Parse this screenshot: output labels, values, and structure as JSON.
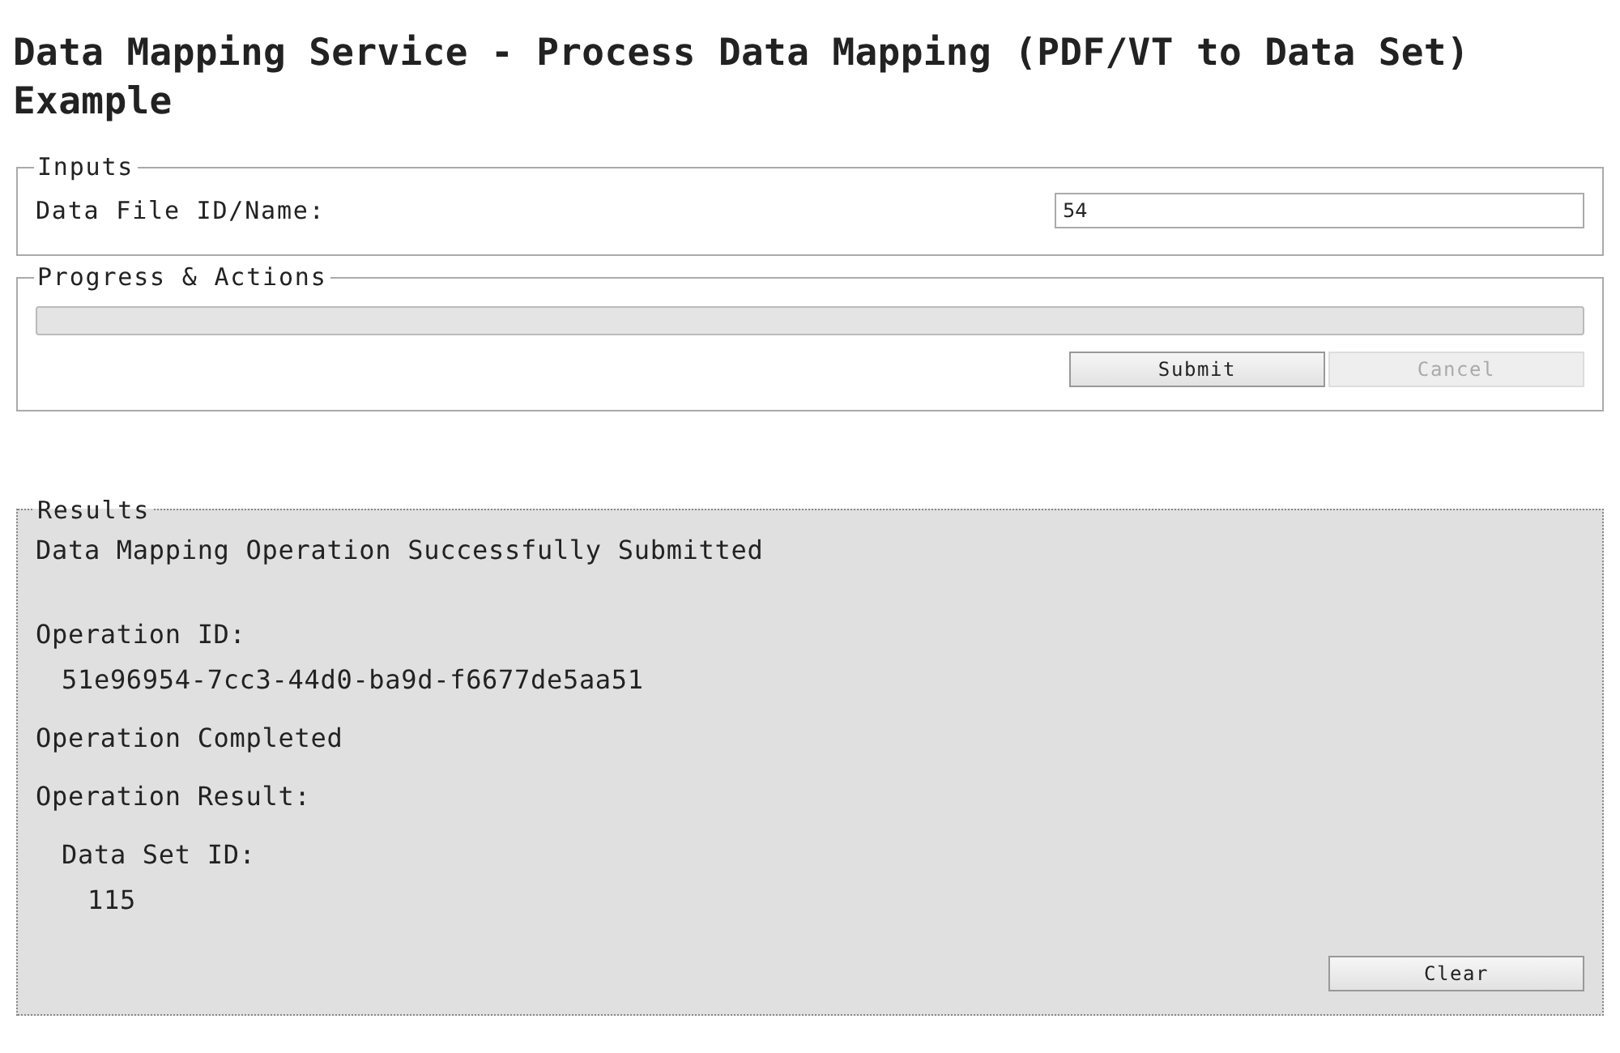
{
  "title": "Data Mapping Service - Process Data Mapping (PDF/VT to Data Set) Example",
  "inputs": {
    "legend": "Inputs",
    "fields": [
      {
        "label": "Data File ID/Name:",
        "value": "54"
      }
    ]
  },
  "progress": {
    "legend": "Progress & Actions",
    "level": 0,
    "buttons": [
      {
        "label": "Submit",
        "disabled": false
      },
      {
        "label": "Cancel",
        "disabled": true
      }
    ]
  },
  "results": {
    "legend": "Results",
    "items": [
      {
        "text": "Data Mapping Operation Successfully Submitted"
      },
      {
        "text": "Operation ID:",
        "children": [
          {
            "text": "51e96954-7cc3-44d0-ba9d-f6677de5aa51"
          }
        ]
      },
      {
        "text": "Operation Completed"
      },
      {
        "text": "Operation Result:",
        "children": [
          {
            "text": "Data Set ID:",
            "children": [
              {
                "text": "115"
              }
            ]
          }
        ]
      }
    ],
    "buttons": [
      {
        "label": "Clear",
        "disabled": false
      }
    ]
  }
}
